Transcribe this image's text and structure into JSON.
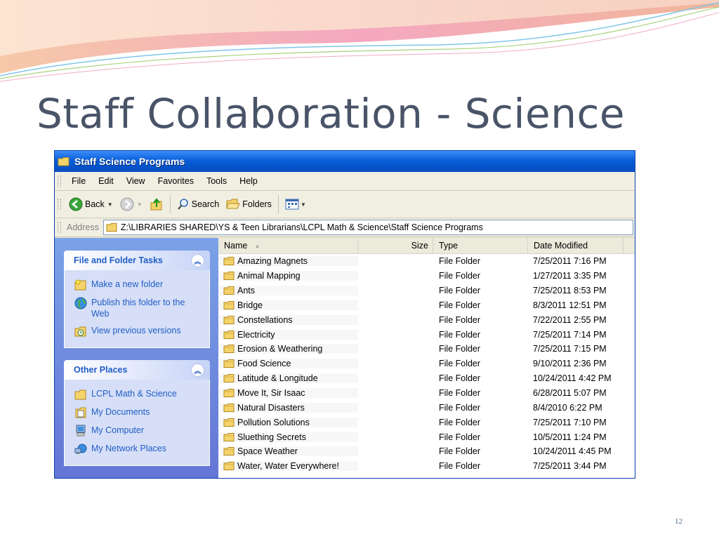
{
  "slide": {
    "title": "Staff Collaboration - Science",
    "page_number": "12"
  },
  "window": {
    "title": "Staff Science Programs",
    "menu": [
      "File",
      "Edit",
      "View",
      "Favorites",
      "Tools",
      "Help"
    ],
    "toolbar": {
      "back_label": "Back",
      "search_label": "Search",
      "folders_label": "Folders"
    },
    "address": {
      "label": "Address",
      "path": "Z:\\LIBRARIES SHARED\\YS & Teen Librarians\\LCPL Math & Science\\Staff Science Programs"
    }
  },
  "taskpane": {
    "file_tasks": {
      "title": "File and Folder Tasks",
      "items": [
        "Make a new folder",
        "Publish this folder to the Web",
        "View previous versions"
      ]
    },
    "other_places": {
      "title": "Other Places",
      "items": [
        "LCPL Math & Science",
        "My Documents",
        "My Computer",
        "My Network Places"
      ]
    }
  },
  "columns": {
    "name": "Name",
    "size": "Size",
    "type": "Type",
    "date": "Date Modified"
  },
  "files": [
    {
      "name": "Amazing Magnets",
      "type": "File Folder",
      "date": "7/25/2011 7:16 PM"
    },
    {
      "name": "Animal Mapping",
      "type": "File Folder",
      "date": "1/27/2011 3:35 PM"
    },
    {
      "name": "Ants",
      "type": "File Folder",
      "date": "7/25/2011 8:53 PM"
    },
    {
      "name": "Bridge",
      "type": "File Folder",
      "date": "8/3/2011 12:51 PM"
    },
    {
      "name": "Constellations",
      "type": "File Folder",
      "date": "7/22/2011 2:55 PM"
    },
    {
      "name": "Electricity",
      "type": "File Folder",
      "date": "7/25/2011 7:14 PM"
    },
    {
      "name": "Erosion & Weathering",
      "type": "File Folder",
      "date": "7/25/2011 7:15 PM"
    },
    {
      "name": "Food Science",
      "type": "File Folder",
      "date": "9/10/2011 2:36 PM"
    },
    {
      "name": "Latitude & Longitude",
      "type": "File Folder",
      "date": "10/24/2011 4:42 PM"
    },
    {
      "name": "Move It, Sir Isaac",
      "type": "File Folder",
      "date": "6/28/2011 5:07 PM"
    },
    {
      "name": "Natural Disasters",
      "type": "File Folder",
      "date": "8/4/2010 6:22 PM"
    },
    {
      "name": "Pollution Solutions",
      "type": "File Folder",
      "date": "7/25/2011 7:10 PM"
    },
    {
      "name": "Sluething Secrets",
      "type": "File Folder",
      "date": "10/5/2011 1:24 PM"
    },
    {
      "name": "Space Weather",
      "type": "File Folder",
      "date": "10/24/2011 4:45 PM"
    },
    {
      "name": "Water, Water Everywhere!",
      "type": "File Folder",
      "date": "7/25/2011 3:44 PM"
    }
  ],
  "colors": {
    "title_text": "#4a5468",
    "xp_blue": "#0a5fd8",
    "task_link": "#215dc6",
    "folder_yellow": "#f5d36b"
  }
}
